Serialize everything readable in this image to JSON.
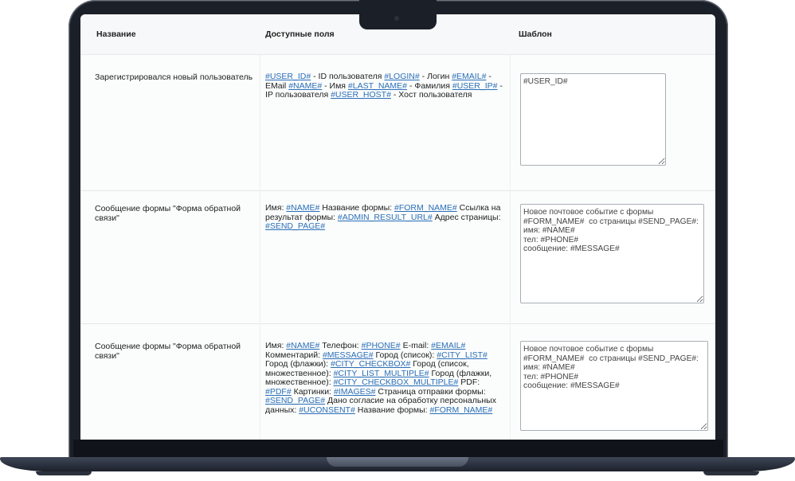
{
  "table": {
    "headers": {
      "name": "Название",
      "fields": "Доступные поля",
      "template": "Шаблон"
    },
    "rows": [
      {
        "name": "Зарегистрировался новый пользователь",
        "fields": [
          {
            "code": "#USER_ID#",
            "desc": " - ID пользователя "
          },
          {
            "code": "#LOGIN#",
            "desc": " - Логин "
          },
          {
            "code": "#EMAIL#",
            "desc": " - EMail "
          },
          {
            "code": "#NAME#",
            "desc": " - Имя "
          },
          {
            "code": "#LAST_NAME#",
            "desc": " - Фамилия "
          },
          {
            "code": "#USER_IP#",
            "desc": " - IP пользователя "
          },
          {
            "code": "#USER_HOST#",
            "desc": " - Хост пользователя"
          }
        ],
        "template": "#USER_ID#"
      },
      {
        "name": "Сообщение формы \"Форма обратной связи\"",
        "fields": [
          {
            "label": "Имя: ",
            "code": "#NAME#"
          },
          {
            "label": " Название формы: ",
            "code": "#FORM_NAME#"
          },
          {
            "label": " Ссылка на результат формы: ",
            "code": "#ADMIN_RESULT_URL#"
          },
          {
            "label": " Адрес страницы: ",
            "code": "#SEND_PAGE#"
          }
        ],
        "template": "Новое почтовое событие с формы\n#FORM_NAME#  со страницы #SEND_PAGE#:\nимя: #NAME#\nтел: #PHONE#\nсообщение: #MESSAGE#"
      },
      {
        "name": "Сообщение формы \"Форма обратной связи\"",
        "fields": [
          {
            "label": "Имя: ",
            "code": "#NAME#"
          },
          {
            "label": " Телефон: ",
            "code": "#PHONE#"
          },
          {
            "label": " E-mail: ",
            "code": "#EMAIL#"
          },
          {
            "label": " Комментарий: ",
            "code": "#MESSAGE#"
          },
          {
            "label": " Город (список): ",
            "code": "#CITY_LIST#"
          },
          {
            "label": " Город (флажки): ",
            "code": "#CITY_CHECKBOX#"
          },
          {
            "label": " Город (список, множественное): ",
            "code": "#CITY_LIST_MULTIPLE#"
          },
          {
            "label": " Город (флажки, множественное): ",
            "code": "#CITY_CHECKBOX_MULTIPLE#"
          },
          {
            "label": " PDF: ",
            "code": "#PDF#"
          },
          {
            "label": " Картинки: ",
            "code": "#IMAGES#"
          },
          {
            "label": " Страница отправки формы: ",
            "code": "#SEND_PAGE#"
          },
          {
            "label": " Дано согласие на обработку персональных данных: ",
            "code": "#UCONSENT#"
          },
          {
            "label": " Название формы: ",
            "code": "#FORM_NAME#"
          }
        ],
        "template": "Новое почтовое событие с формы\n#FORM_NAME#  со страницы #SEND_PAGE#:\nимя: #NAME#\nтел: #PHONE#\nсообщение: #MESSAGE#"
      }
    ]
  }
}
